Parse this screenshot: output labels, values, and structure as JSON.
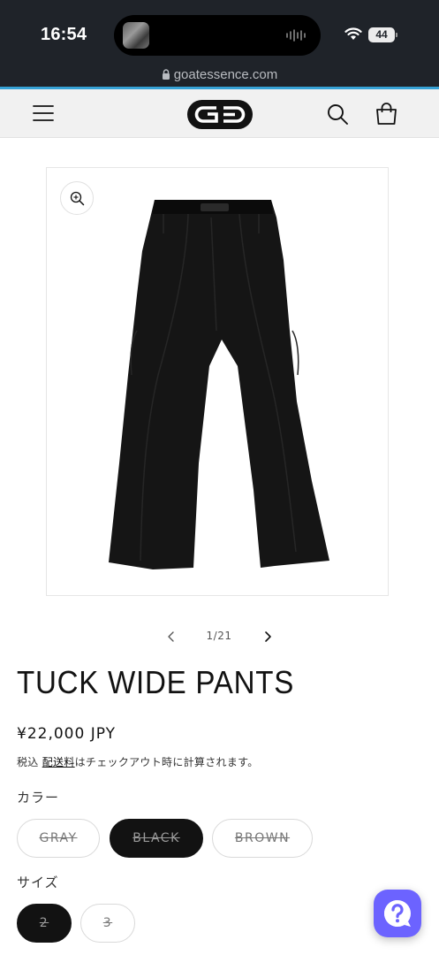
{
  "status_bar": {
    "time": "16:54",
    "battery": "44",
    "url": "goatessence.com"
  },
  "header": {
    "logo_alt": "GE",
    "icons": [
      "menu-icon",
      "logo-icon",
      "search-icon",
      "cart-icon"
    ]
  },
  "gallery": {
    "page_count": "1/21",
    "icons": [
      "zoom-icon",
      "chevron-left-icon",
      "chevron-right-icon"
    ]
  },
  "product": {
    "title": "TUCK WIDE PANTS",
    "price": "¥22,000 JPY",
    "tax_prefix": "税込 ",
    "shipping_link": "配送料",
    "tax_suffix": "はチェックアウト時に計算されます。"
  },
  "color_option": {
    "label": "カラー",
    "choices": [
      "GRAY",
      "BLACK",
      "BROWN"
    ],
    "selected": "BLACK"
  },
  "size_option": {
    "label": "サイズ",
    "choices": [
      "2",
      "3"
    ],
    "selected": "2"
  },
  "colors": {
    "accent": "#36a2d6",
    "status_bar": "#1f2329",
    "selected_pill": "#121212",
    "chat": "#6c63ff"
  }
}
